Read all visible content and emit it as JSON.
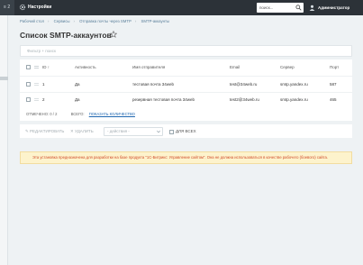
{
  "topbar": {
    "counter": "2",
    "settings_label": "Настройки",
    "search_placeholder": "поиск...",
    "user_label": "Администратор"
  },
  "breadcrumb": [
    "Рабочий стол",
    "Сервисы",
    "Отправка почты через SMTP",
    "SMTP-аккаунты"
  ],
  "page_title": "Список SMTP-аккаунтов",
  "filter_placeholder": "Фильтр + поиск",
  "table": {
    "headers": {
      "id": "ID",
      "active": "Активность",
      "sender": "Имя отправителя",
      "email": "Email",
      "server": "Сервер",
      "port": "Порт"
    },
    "rows": [
      {
        "id": "1",
        "active": "Да",
        "sender": "тестовая почта 34web",
        "email": "test@34web.ru",
        "server": "smtp.yandex.ru",
        "port": "587"
      },
      {
        "id": "2",
        "active": "Да",
        "sender": "резервная тестовая почта 34web",
        "email": "test2@34web.ru",
        "server": "smtp.yandex.ru",
        "port": "465"
      }
    ],
    "selected_label": "ОТМЕЧЕНО: 0 / 2",
    "total_label": "ВСЕГО:",
    "show_count_label": "ПОКАЗАТЬ КОЛИЧЕСТВО"
  },
  "actions": {
    "edit_label": "РЕДАКТИРОВАТЬ",
    "delete_label": "УДАЛИТЬ",
    "select_value": "- действия -",
    "for_all_label": "ДЛЯ ВСЕХ"
  },
  "warning_text": "Эта установка предназначена для разработки на базе продукта \"1С-Битрикс: Управление сайтом\". Она не должна использоваться в качестве рабочего (боевого) сайта.",
  "colors": {
    "topbar": "#2c3238",
    "link": "#2067b0",
    "warning_text": "#d04a2a",
    "warning_bg": "#fdf3cc"
  }
}
